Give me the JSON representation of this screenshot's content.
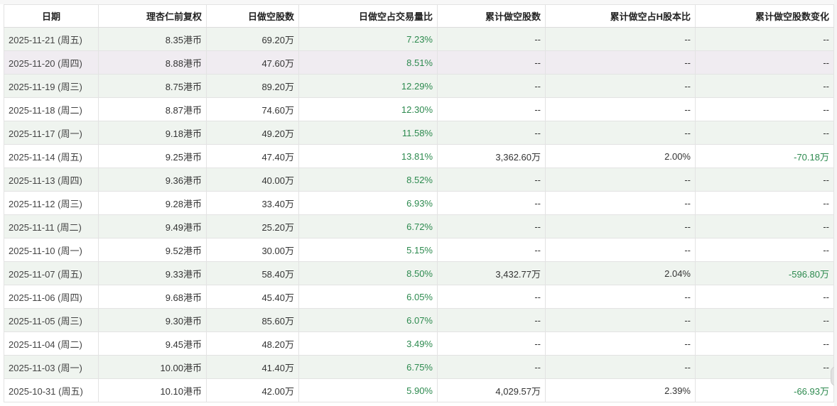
{
  "headers": [
    "日期",
    "理杏仁前复权",
    "日做空股数",
    "日做空占交易量比",
    "累计做空股数",
    "累计做空占H股本比",
    "累计做空股数变化"
  ],
  "rows": [
    {
      "date": "2025-11-21 (周五)",
      "price": "8.35港币",
      "short_shares": "69.20万",
      "short_ratio": "7.23%",
      "cum_short": "--",
      "cum_ratio": "--",
      "cum_change": "--",
      "bg": "g"
    },
    {
      "date": "2025-11-20 (周四)",
      "price": "8.88港币",
      "short_shares": "47.60万",
      "short_ratio": "8.51%",
      "cum_short": "--",
      "cum_ratio": "--",
      "cum_change": "--",
      "bg": "p"
    },
    {
      "date": "2025-11-19 (周三)",
      "price": "8.75港币",
      "short_shares": "89.20万",
      "short_ratio": "12.29%",
      "cum_short": "--",
      "cum_ratio": "--",
      "cum_change": "--",
      "bg": "g"
    },
    {
      "date": "2025-11-18 (周二)",
      "price": "8.87港币",
      "short_shares": "74.60万",
      "short_ratio": "12.30%",
      "cum_short": "--",
      "cum_ratio": "--",
      "cum_change": "--",
      "bg": "w"
    },
    {
      "date": "2025-11-17 (周一)",
      "price": "9.18港币",
      "short_shares": "49.20万",
      "short_ratio": "11.58%",
      "cum_short": "--",
      "cum_ratio": "--",
      "cum_change": "--",
      "bg": "g"
    },
    {
      "date": "2025-11-14 (周五)",
      "price": "9.25港币",
      "short_shares": "47.40万",
      "short_ratio": "13.81%",
      "cum_short": "3,362.60万",
      "cum_ratio": "2.00%",
      "cum_change": "-70.18万",
      "bg": "w"
    },
    {
      "date": "2025-11-13 (周四)",
      "price": "9.36港币",
      "short_shares": "40.00万",
      "short_ratio": "8.52%",
      "cum_short": "--",
      "cum_ratio": "--",
      "cum_change": "--",
      "bg": "g"
    },
    {
      "date": "2025-11-12 (周三)",
      "price": "9.28港币",
      "short_shares": "33.40万",
      "short_ratio": "6.93%",
      "cum_short": "--",
      "cum_ratio": "--",
      "cum_change": "--",
      "bg": "w"
    },
    {
      "date": "2025-11-11 (周二)",
      "price": "9.49港币",
      "short_shares": "25.20万",
      "short_ratio": "6.72%",
      "cum_short": "--",
      "cum_ratio": "--",
      "cum_change": "--",
      "bg": "g"
    },
    {
      "date": "2025-11-10 (周一)",
      "price": "9.52港币",
      "short_shares": "30.00万",
      "short_ratio": "5.15%",
      "cum_short": "--",
      "cum_ratio": "--",
      "cum_change": "--",
      "bg": "w"
    },
    {
      "date": "2025-11-07 (周五)",
      "price": "9.33港币",
      "short_shares": "58.40万",
      "short_ratio": "8.50%",
      "cum_short": "3,432.77万",
      "cum_ratio": "2.04%",
      "cum_change": "-596.80万",
      "bg": "g"
    },
    {
      "date": "2025-11-06 (周四)",
      "price": "9.68港币",
      "short_shares": "45.40万",
      "short_ratio": "6.05%",
      "cum_short": "--",
      "cum_ratio": "--",
      "cum_change": "--",
      "bg": "w"
    },
    {
      "date": "2025-11-05 (周三)",
      "price": "9.30港币",
      "short_shares": "85.60万",
      "short_ratio": "6.07%",
      "cum_short": "--",
      "cum_ratio": "--",
      "cum_change": "--",
      "bg": "g"
    },
    {
      "date": "2025-11-04 (周二)",
      "price": "9.45港币",
      "short_shares": "48.20万",
      "short_ratio": "3.49%",
      "cum_short": "--",
      "cum_ratio": "--",
      "cum_change": "--",
      "bg": "w"
    },
    {
      "date": "2025-11-03 (周一)",
      "price": "10.00港币",
      "short_shares": "41.40万",
      "short_ratio": "6.75%",
      "cum_short": "--",
      "cum_ratio": "--",
      "cum_change": "--",
      "bg": "g"
    },
    {
      "date": "2025-10-31 (周五)",
      "price": "10.10港币",
      "short_shares": "42.00万",
      "short_ratio": "5.90%",
      "cum_short": "4,029.57万",
      "cum_ratio": "2.39%",
      "cum_change": "-66.93万",
      "bg": "w"
    }
  ],
  "colors": {
    "positive_green": "#2d8a4f",
    "row_green": "#eff4ef",
    "row_highlight": "#f0ecf1"
  }
}
